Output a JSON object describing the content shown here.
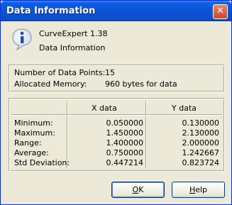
{
  "window": {
    "title": "Data Information",
    "close_glyph": "✕"
  },
  "header": {
    "app_name": "CurveExpert 1.38",
    "subtitle": "Data Information",
    "icon": "info-icon"
  },
  "summary": {
    "points_label": "Number of Data Points:",
    "points_value": "15",
    "memory_label": "Allocated Memory:",
    "memory_value": "960 bytes for data"
  },
  "stats": {
    "columns": [
      "X data",
      "Y data"
    ],
    "rows": [
      {
        "label": "Minimum:",
        "x": "0.050000",
        "y": "0.130000"
      },
      {
        "label": "Maximum:",
        "x": "1.450000",
        "y": "2.130000"
      },
      {
        "label": "Range:",
        "x": "1.400000",
        "y": "2.000000"
      },
      {
        "label": "Average:",
        "x": "0.750000",
        "y": "1.242667"
      },
      {
        "label": "Std Deviation:",
        "x": "0.447214",
        "y": "0.823724"
      }
    ]
  },
  "buttons": {
    "ok_u": "O",
    "ok_rest": "K",
    "help_u": "H",
    "help_rest": "elp"
  }
}
